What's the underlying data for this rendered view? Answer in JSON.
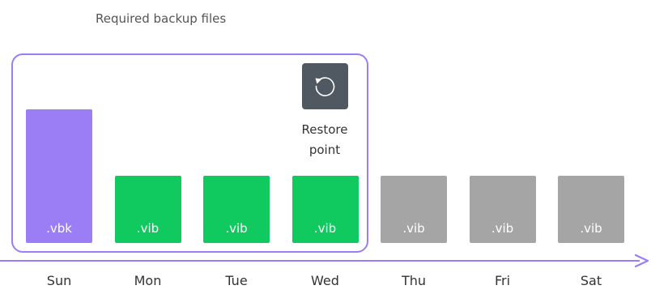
{
  "caption": "Required backup files",
  "restore_point": {
    "line1": "Restore",
    "line2": "point",
    "icon": "restore-icon"
  },
  "days": [
    {
      "day": "Sun",
      "file": ".vbk",
      "type": "full",
      "required": true
    },
    {
      "day": "Mon",
      "file": ".vib",
      "type": "incremental",
      "required": true
    },
    {
      "day": "Tue",
      "file": ".vib",
      "type": "incremental",
      "required": true
    },
    {
      "day": "Wed",
      "file": ".vib",
      "type": "incremental",
      "required": true
    },
    {
      "day": "Thu",
      "file": ".vib",
      "type": "incremental",
      "required": false
    },
    {
      "day": "Fri",
      "file": ".vib",
      "type": "incremental",
      "required": false
    },
    {
      "day": "Sat",
      "file": ".vib",
      "type": "incremental",
      "required": false
    }
  ],
  "colors": {
    "full": "#9b7df5",
    "required_incremental": "#10c95f",
    "not_required": "#a5a5a5",
    "accent": "#9b7df5",
    "icon_bg": "#505861"
  }
}
